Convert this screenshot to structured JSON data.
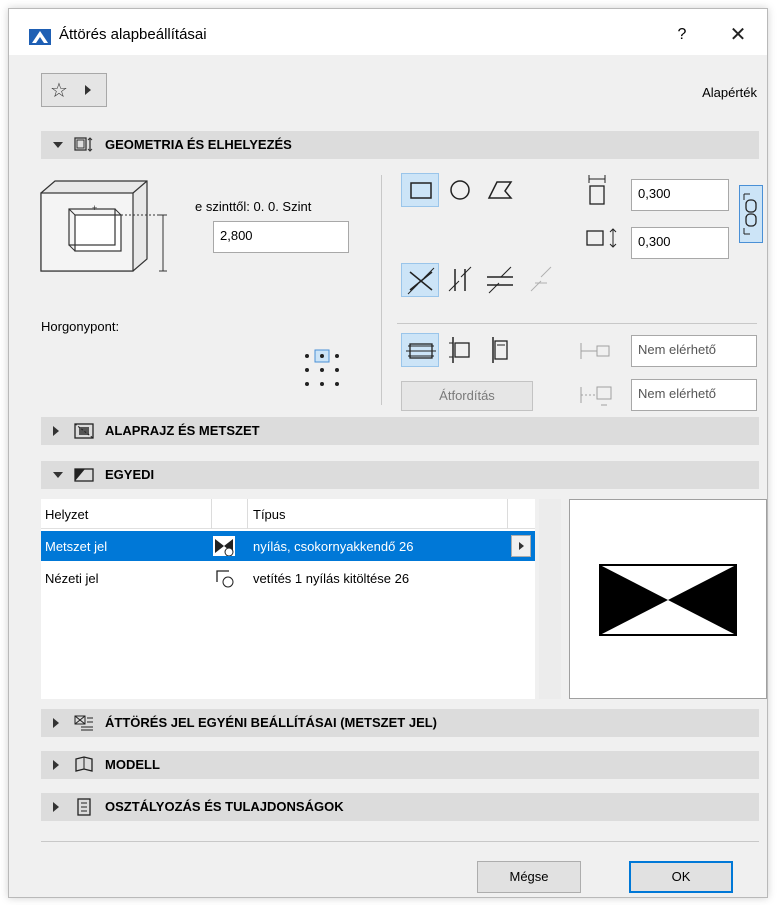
{
  "window": {
    "title": "Áttörés alapbeállításai",
    "help_label": "?",
    "close_label": "✕"
  },
  "toolbar": {
    "favorites_icon": "star-icon",
    "default_label": "Alapérték"
  },
  "sections": {
    "geometry": {
      "title": "GEOMETRIA ÉS ELHELYEZÉS",
      "expanded": true
    },
    "floorplan": {
      "title": "ALAPRAJZ ÉS METSZET",
      "expanded": false
    },
    "custom": {
      "title": "EGYEDI",
      "expanded": true
    },
    "marker": {
      "title": "ÁTTÖRÉS JEL EGYÉNI BEÁLLÍTÁSAI (METSZET JEL)",
      "expanded": false
    },
    "model": {
      "title": "MODELL",
      "expanded": false
    },
    "classification": {
      "title": "OSZTÁLYOZÁS ÉS TULAJDONSÁGOK",
      "expanded": false
    }
  },
  "geometry": {
    "level_label": "e szinttől: 0. 0. Szint",
    "level_value": "2,800",
    "anchor_label": "Horgonypont:",
    "width_value": "0,300",
    "height_value": "0,300",
    "flip_label": "Átfordítás",
    "not_available_1": "Nem elérhető",
    "not_available_2": "Nem elérhető"
  },
  "custom_table": {
    "headers": [
      "Helyzet",
      "Típus"
    ],
    "rows": [
      {
        "position": "Metszet jel",
        "type": "nyílás, csokornyakkendő 26",
        "selected": true
      },
      {
        "position": "Nézeti jel",
        "type": "vetítés 1 nyílás kitöltése 26",
        "selected": false
      }
    ]
  },
  "buttons": {
    "cancel": "Mégse",
    "ok": "OK"
  },
  "colors": {
    "selection": "#0078d7",
    "section_header": "#dcdcdc",
    "icon_selected_bg": "#cce4f7"
  }
}
